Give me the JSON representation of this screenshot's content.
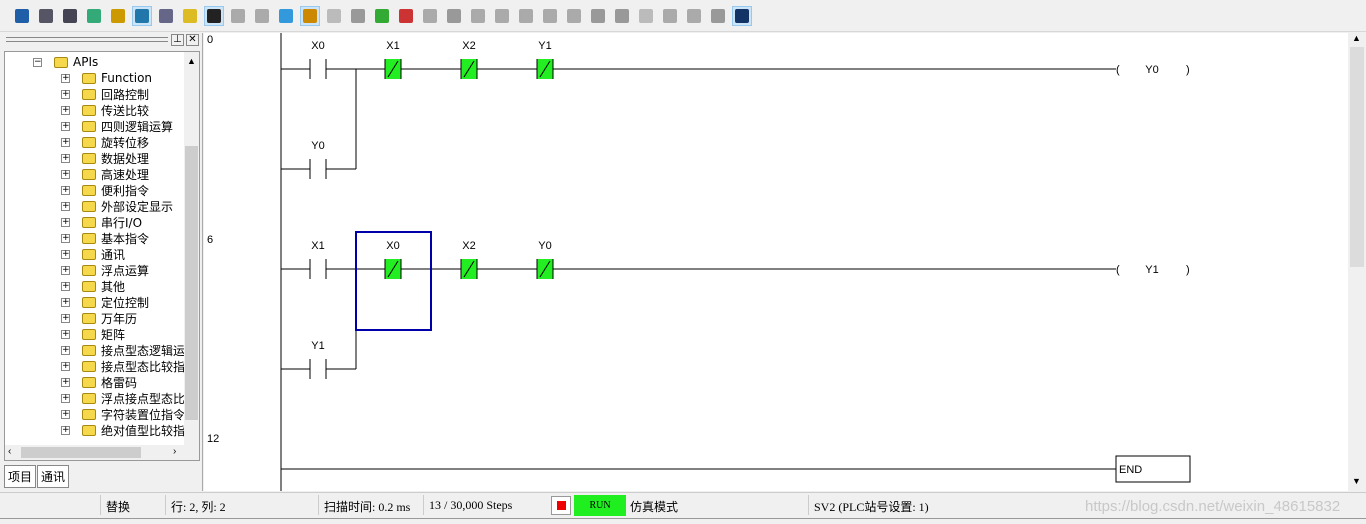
{
  "toolbar": {
    "icons": [
      "ld-out-icon",
      "instruction-list-icon",
      "ladder-icon",
      "online-icon",
      "edit-icon",
      "tree-icon",
      "table-icon",
      "memo-icon",
      "pen-icon",
      "comment-icon",
      "comment2-icon",
      "pin-icon",
      "ladder-mode-icon",
      "grid-icon",
      "monitor-icon",
      "run-icon",
      "stop-icon",
      "transfer-icon",
      "download-icon",
      "probe-icon",
      "code-icon",
      "code2-icon",
      "bits-icon",
      "bits2-icon",
      "step-icon",
      "branch-icon",
      "window-icon",
      "m-icon",
      "ip-icon",
      "device-icon",
      "settings-icon"
    ],
    "active": [
      5,
      8,
      12,
      30
    ]
  },
  "left_panel": {
    "tree": [
      {
        "label": "APIs",
        "level": 0,
        "expanded": true
      },
      {
        "label": "Function"
      },
      {
        "label": "回路控制"
      },
      {
        "label": "传送比较"
      },
      {
        "label": "四则逻辑运算"
      },
      {
        "label": "旋转位移"
      },
      {
        "label": "数据处理"
      },
      {
        "label": "高速处理"
      },
      {
        "label": "便利指令"
      },
      {
        "label": "外部设定显示"
      },
      {
        "label": "串行I/O"
      },
      {
        "label": "基本指令"
      },
      {
        "label": "通讯"
      },
      {
        "label": "浮点运算"
      },
      {
        "label": "其他"
      },
      {
        "label": "定位控制"
      },
      {
        "label": "万年历"
      },
      {
        "label": "矩阵"
      },
      {
        "label": "接点型态逻辑运"
      },
      {
        "label": "接点型态比较指"
      },
      {
        "label": "格雷码"
      },
      {
        "label": "浮点接点型态比"
      },
      {
        "label": "字符装置位指令"
      },
      {
        "label": "绝对值型比较指"
      }
    ],
    "tabs": [
      "项目",
      "通讯"
    ]
  },
  "ladder": {
    "rungs": [
      {
        "step": "0",
        "main": [
          {
            "label": "X0",
            "type": "NO",
            "on": false
          },
          {
            "label": "X1",
            "type": "NC",
            "on": true
          },
          {
            "label": "X2",
            "type": "NC",
            "on": true
          },
          {
            "label": "Y1",
            "type": "NC",
            "on": true
          }
        ],
        "branch": {
          "label": "Y0",
          "type": "NO",
          "on": false
        },
        "coil": "Y0"
      },
      {
        "step": "6",
        "main": [
          {
            "label": "X1",
            "type": "NO",
            "on": false
          },
          {
            "label": "X0",
            "type": "NC",
            "on": true
          },
          {
            "label": "X2",
            "type": "NC",
            "on": true
          },
          {
            "label": "Y0",
            "type": "NC",
            "on": true
          }
        ],
        "branch": {
          "label": "Y1",
          "type": "NO",
          "on": false
        },
        "coil": "Y1"
      },
      {
        "step": "12",
        "end": "END"
      }
    ],
    "cursor": {
      "rung": 1,
      "column": 1
    },
    "colors": {
      "active_contact": "#22ee22",
      "cursor": "#0000aa"
    }
  },
  "status": {
    "mode": "替换",
    "position": "行: 2, 列: 2",
    "scan_time": "扫描时间: 0.2 ms",
    "steps": "13 / 30,000 Steps",
    "run": "RUN",
    "sim": "仿真模式",
    "station": "SV2 (PLC站号设置: 1)"
  },
  "watermark": "https://blog.csdn.net/weixin_48615832"
}
